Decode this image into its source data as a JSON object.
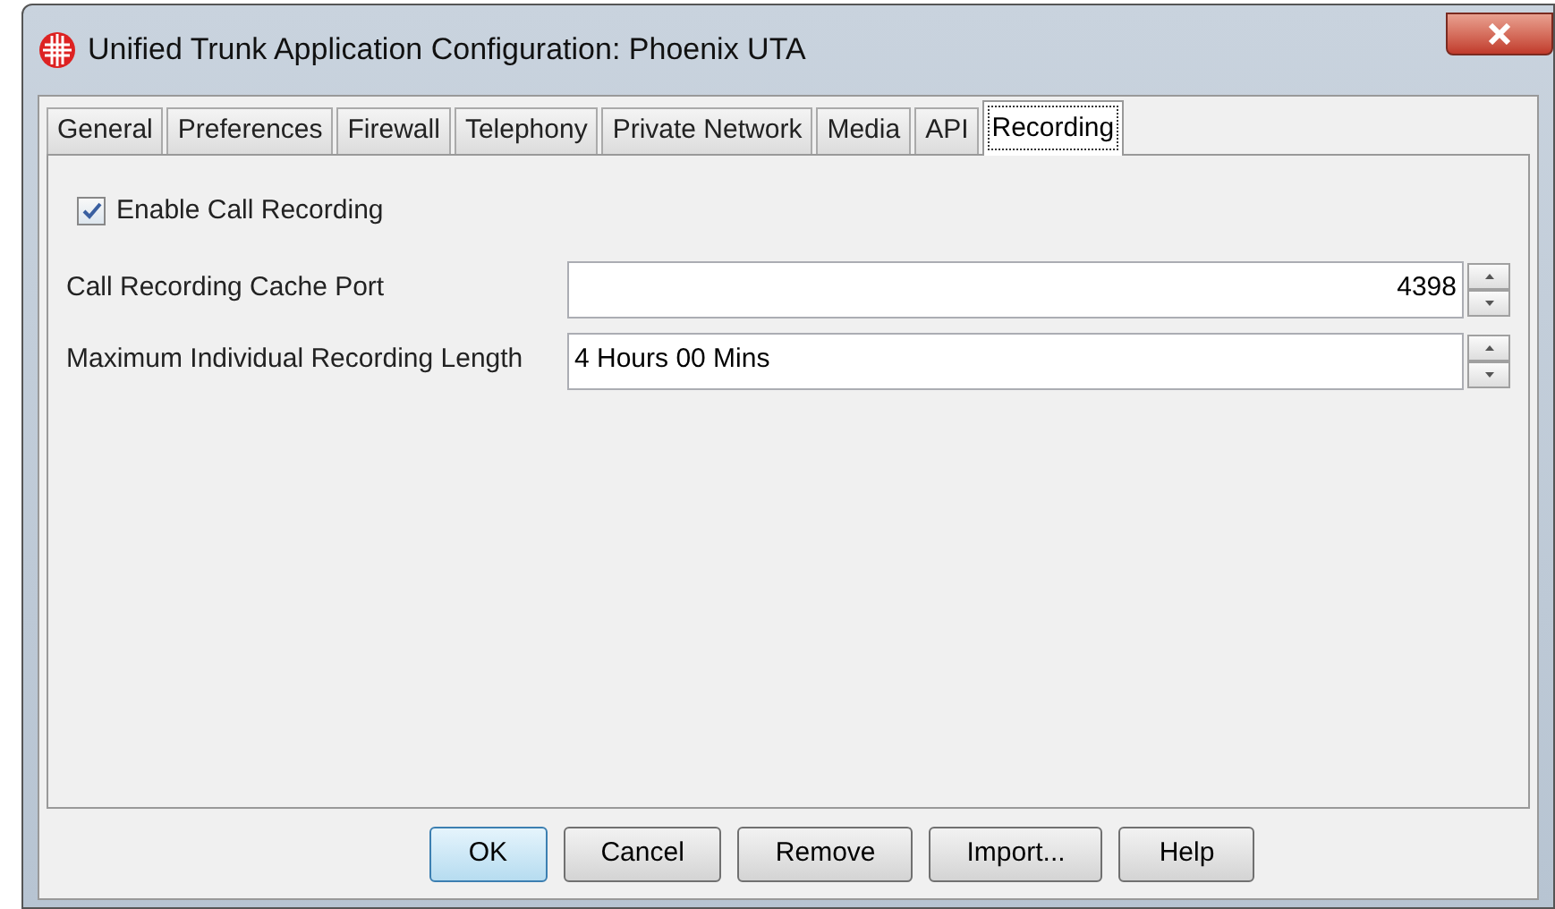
{
  "window": {
    "title": "Unified Trunk Application Configuration: Phoenix UTA"
  },
  "tabs": [
    {
      "label": "General",
      "selected": false
    },
    {
      "label": "Preferences",
      "selected": false
    },
    {
      "label": "Firewall",
      "selected": false
    },
    {
      "label": "Telephony",
      "selected": false
    },
    {
      "label": "Private Network",
      "selected": false
    },
    {
      "label": "Media",
      "selected": false
    },
    {
      "label": "API",
      "selected": false
    },
    {
      "label": "Recording",
      "selected": true
    }
  ],
  "enable_call_recording": {
    "label": "Enable Call Recording",
    "checked": true
  },
  "fields": [
    {
      "label": "Call Recording Cache Port",
      "value": "4398",
      "kind": "number"
    },
    {
      "label": "Maximum Individual Recording Length",
      "value": "4 Hours 00 Mins",
      "kind": "duration"
    }
  ],
  "buttons": [
    {
      "label": "OK",
      "default": true
    },
    {
      "label": "Cancel",
      "default": false
    },
    {
      "label": "Remove",
      "default": false
    },
    {
      "label": "Import...",
      "default": false
    },
    {
      "label": "Help",
      "default": false
    }
  ]
}
